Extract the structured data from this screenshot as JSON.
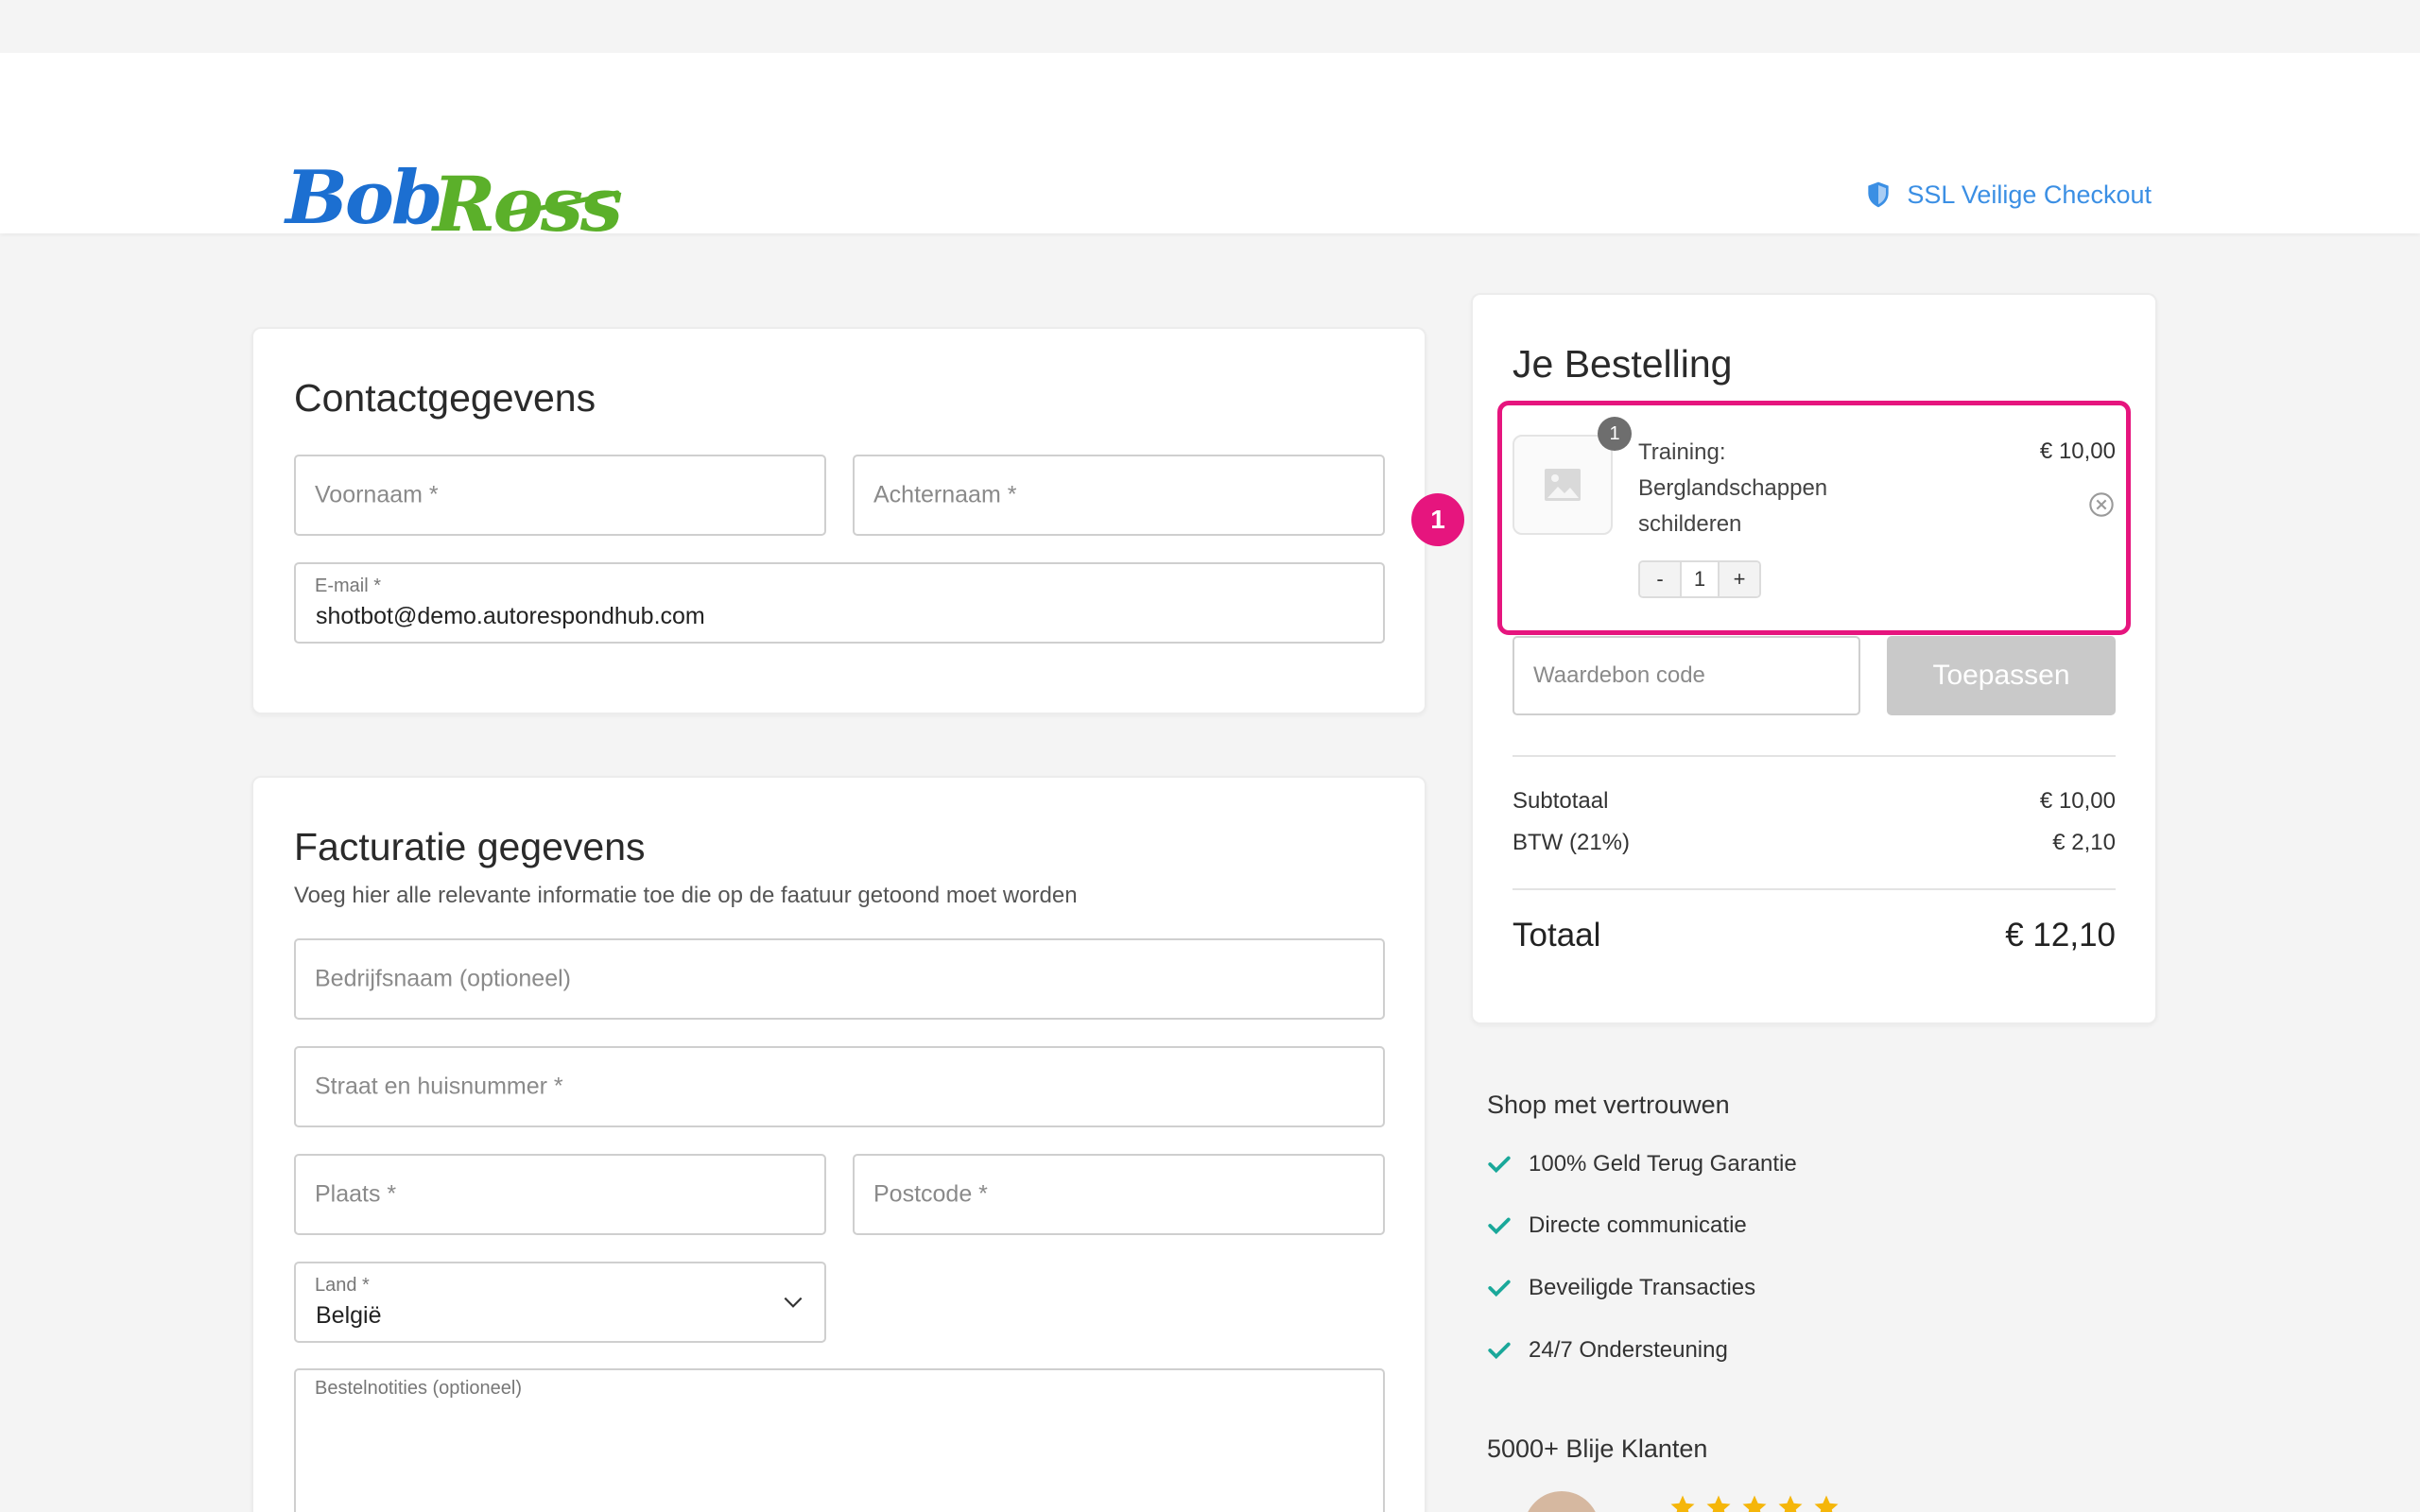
{
  "header": {
    "logo": "Bob Ross",
    "ssl_label": "SSL Veilige Checkout",
    "icon": "shield-icon"
  },
  "contact": {
    "title": "Contactgegevens",
    "first_name_placeholder": "Voornaam *",
    "last_name_placeholder": "Achternaam *",
    "email_label": "E-mail *",
    "email_value": "shotbot@demo.autorespondhub.com"
  },
  "billing": {
    "title": "Facturatie gegevens",
    "subtitle": "Voeg hier alle relevante informatie toe die op de faatuur getoond moet worden",
    "company_placeholder": "Bedrijfsnaam (optioneel)",
    "street_placeholder": "Straat en huisnummer *",
    "city_placeholder": "Plaats *",
    "postcode_placeholder": "Postcode *",
    "country_label": "Land *",
    "country_value": "België",
    "notes_label": "Bestelnotities (optioneel)"
  },
  "step_badge": "1",
  "order": {
    "title": "Je Bestelling",
    "item": {
      "quantity_badge": "1",
      "name": "Training: Berglandschappen schilderen",
      "price": "€ 10,00",
      "minus": "-",
      "quantity": "1",
      "plus": "+"
    },
    "coupon_placeholder": "Waardebon code",
    "apply_label": "Toepassen",
    "subtotal_label": "Subtotaal",
    "subtotal_value": "€ 10,00",
    "vat_label": "BTW (21%)",
    "vat_value": "€ 2,10",
    "total_label": "Totaal",
    "total_value": "€ 12,10"
  },
  "trust": {
    "title": "Shop met vertrouwen",
    "items": [
      "100% Geld Terug Garantie",
      "Directe communicatie",
      "Beveiligde Transacties",
      "24/7 Ondersteuning"
    ],
    "happy_title": "5000+ Blije Klanten",
    "rating_stars": 5
  },
  "colors": {
    "accent_blue": "#3b8fe4",
    "highlight_pink": "#e6157e",
    "check_teal": "#1aa89a",
    "star_gold": "#f5b60a",
    "logo_blue": "#1c6fd1",
    "logo_green": "#5bb02a"
  }
}
